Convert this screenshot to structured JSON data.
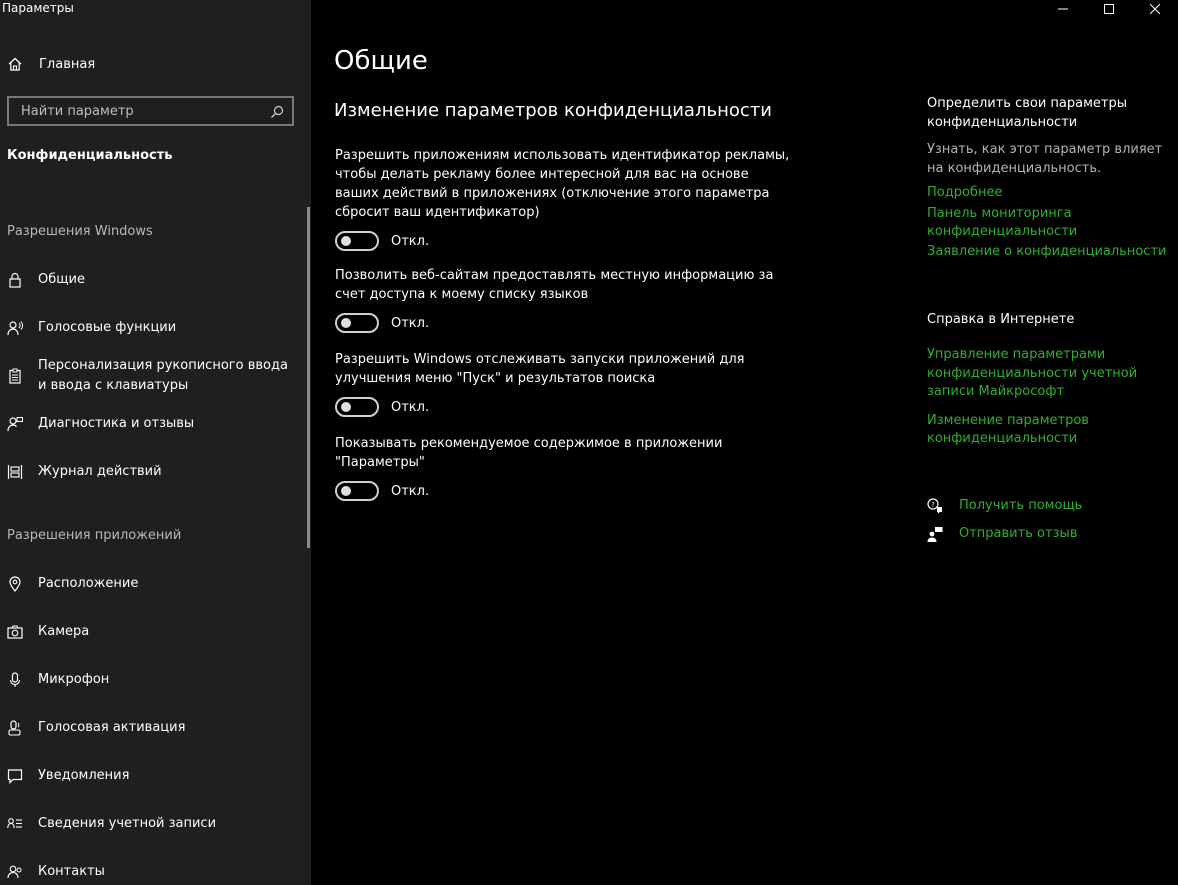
{
  "window": {
    "title": "Параметры"
  },
  "sidebar": {
    "home_label": "Главная",
    "search_placeholder": "Найти параметр",
    "current_section": "Конфиденциальность",
    "group_windows": "Разрешения Windows",
    "windows_items": [
      {
        "label": "Общие",
        "icon": "lock-icon"
      },
      {
        "label": "Голосовые функции",
        "icon": "speech-icon"
      },
      {
        "label": "Персонализация рукописного ввода и ввода с клавиатуры",
        "icon": "clipboard-icon"
      },
      {
        "label": "Диагностика и отзывы",
        "icon": "feedback-person-icon"
      },
      {
        "label": "Журнал действий",
        "icon": "timeline-icon"
      }
    ],
    "group_apps": "Разрешения приложений",
    "app_items": [
      {
        "label": "Расположение",
        "icon": "location-icon"
      },
      {
        "label": "Камера",
        "icon": "camera-icon"
      },
      {
        "label": "Микрофон",
        "icon": "microphone-icon"
      },
      {
        "label": "Голосовая активация",
        "icon": "voice-activation-icon"
      },
      {
        "label": "Уведомления",
        "icon": "notification-icon"
      },
      {
        "label": "Сведения учетной записи",
        "icon": "account-info-icon"
      },
      {
        "label": "Контакты",
        "icon": "contacts-icon"
      }
    ]
  },
  "main": {
    "page_title": "Общие",
    "section_title": "Изменение параметров конфиденциальности",
    "settings": [
      {
        "description": "Разрешить приложениям использовать идентификатор рекламы, чтобы делать рекламу более интересной для вас на основе ваших действий в приложениях (отключение этого параметра сбросит ваш идентификатор)",
        "state_label": "Откл.",
        "enabled": false
      },
      {
        "description": "Позволить веб-сайтам предоставлять местную информацию за счет доступа к моему списку языков",
        "state_label": "Откл.",
        "enabled": false
      },
      {
        "description": "Разрешить Windows отслеживать запуски приложений для улучшения меню \"Пуск\" и результатов поиска",
        "state_label": "Откл.",
        "enabled": false
      },
      {
        "description": "Показывать рекомендуемое содержимое в приложении \"Параметры\"",
        "state_label": "Откл.",
        "enabled": false
      }
    ]
  },
  "aside": {
    "privacy_heading": "Определить свои параметры конфиденциальности",
    "privacy_text": "Узнать, как этот параметр влияет на конфиденциальность.",
    "privacy_links": [
      "Подробнее",
      "Панель мониторинга конфиденциальности",
      "Заявление о конфиденциальности"
    ],
    "help_heading": "Справка в Интернете",
    "help_links": [
      "Управление параметрами конфиденциальности учетной записи Майкрософт",
      "Изменение параметров конфиденциальности"
    ],
    "get_help": "Получить помощь",
    "send_feedback": "Отправить отзыв"
  },
  "colors": {
    "sidebar_bg": "#1f1f1f",
    "main_bg": "#000000",
    "link": "#2fb02f"
  }
}
